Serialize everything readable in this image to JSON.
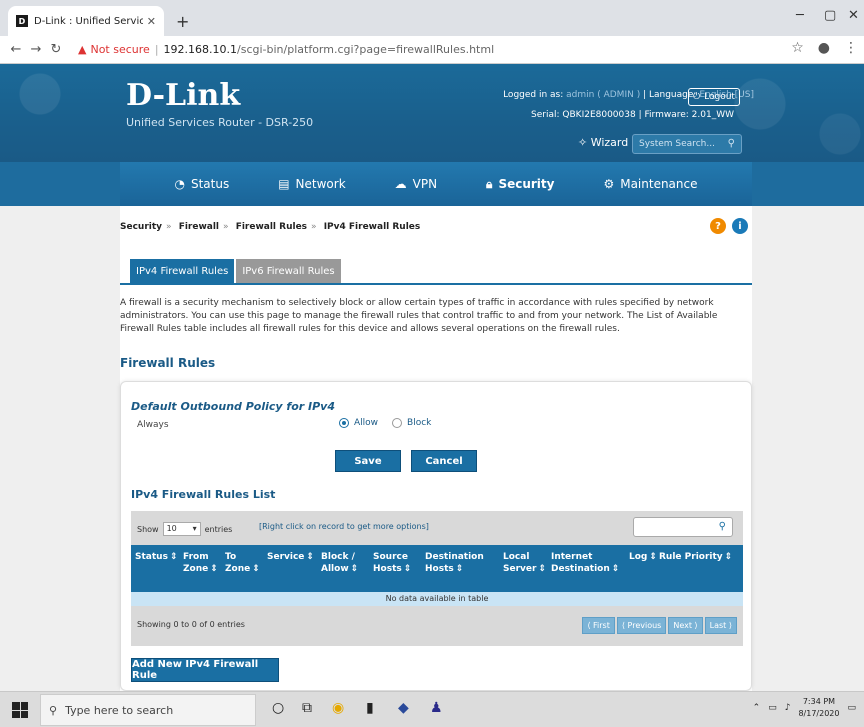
{
  "browser": {
    "tab_title": "D-Link : Unified Services Router",
    "url_warning": "Not secure",
    "url_host": "192.168.10.1",
    "url_path": "/scgi-bin/platform.cgi?page=firewallRules.html"
  },
  "header": {
    "logo": "D-Link",
    "subtitle": "Unified Services Router - DSR-250",
    "logged_in_label": "Logged in as:",
    "logged_in_value": "admin ( ADMIN )",
    "language_label": "Language:",
    "language_value": "English [US]",
    "serial_label": "Serial:",
    "serial_value": "QBKI2E8000038",
    "firmware_label": "Firmware:",
    "firmware_value": "2.01_WW",
    "logout": "Logout",
    "wizard": "Wizard",
    "search_placeholder": "System Search..."
  },
  "nav": {
    "status": "Status",
    "network": "Network",
    "vpn": "VPN",
    "security": "Security",
    "maintenance": "Maintenance"
  },
  "breadcrumb": [
    "Security",
    "Firewall",
    "Firewall Rules",
    "IPv4 Firewall Rules"
  ],
  "tabs": [
    "IPv4 Firewall Rules",
    "IPv6 Firewall Rules"
  ],
  "description": "A firewall is a security mechanism to selectively block or allow certain types of traffic in accordance with rules specified by network administrators. You can use this page to manage the firewall rules that control traffic to and from your network. The List of Available Firewall Rules table includes all firewall rules for this device and allows several operations on the firewall rules.",
  "section_title": "Firewall Rules",
  "policy": {
    "title": "Default Outbound Policy for IPv4",
    "always": "Always",
    "allow": "Allow",
    "block": "Block",
    "save": "Save",
    "cancel": "Cancel"
  },
  "list": {
    "title": "IPv4 Firewall Rules List",
    "show": "Show",
    "show_value": "10",
    "entries": "entries",
    "hint": "[Right click on record to get more options]",
    "columns": [
      "Status",
      "From Zone",
      "To Zone",
      "Service",
      "Block / Allow",
      "Source Hosts",
      "Destination Hosts",
      "Local Server",
      "Internet Destination",
      "Log",
      "Rule Priority"
    ],
    "no_data": "No data available in table",
    "showing": "Showing 0 to 0 of 0 entries",
    "pager": [
      "First",
      "Previous",
      "Next",
      "Last"
    ],
    "add_button": "Add New IPv4 Firewall Rule"
  },
  "taskbar": {
    "search": "Type here to search",
    "time": "7:34 PM",
    "date": "8/17/2020"
  }
}
